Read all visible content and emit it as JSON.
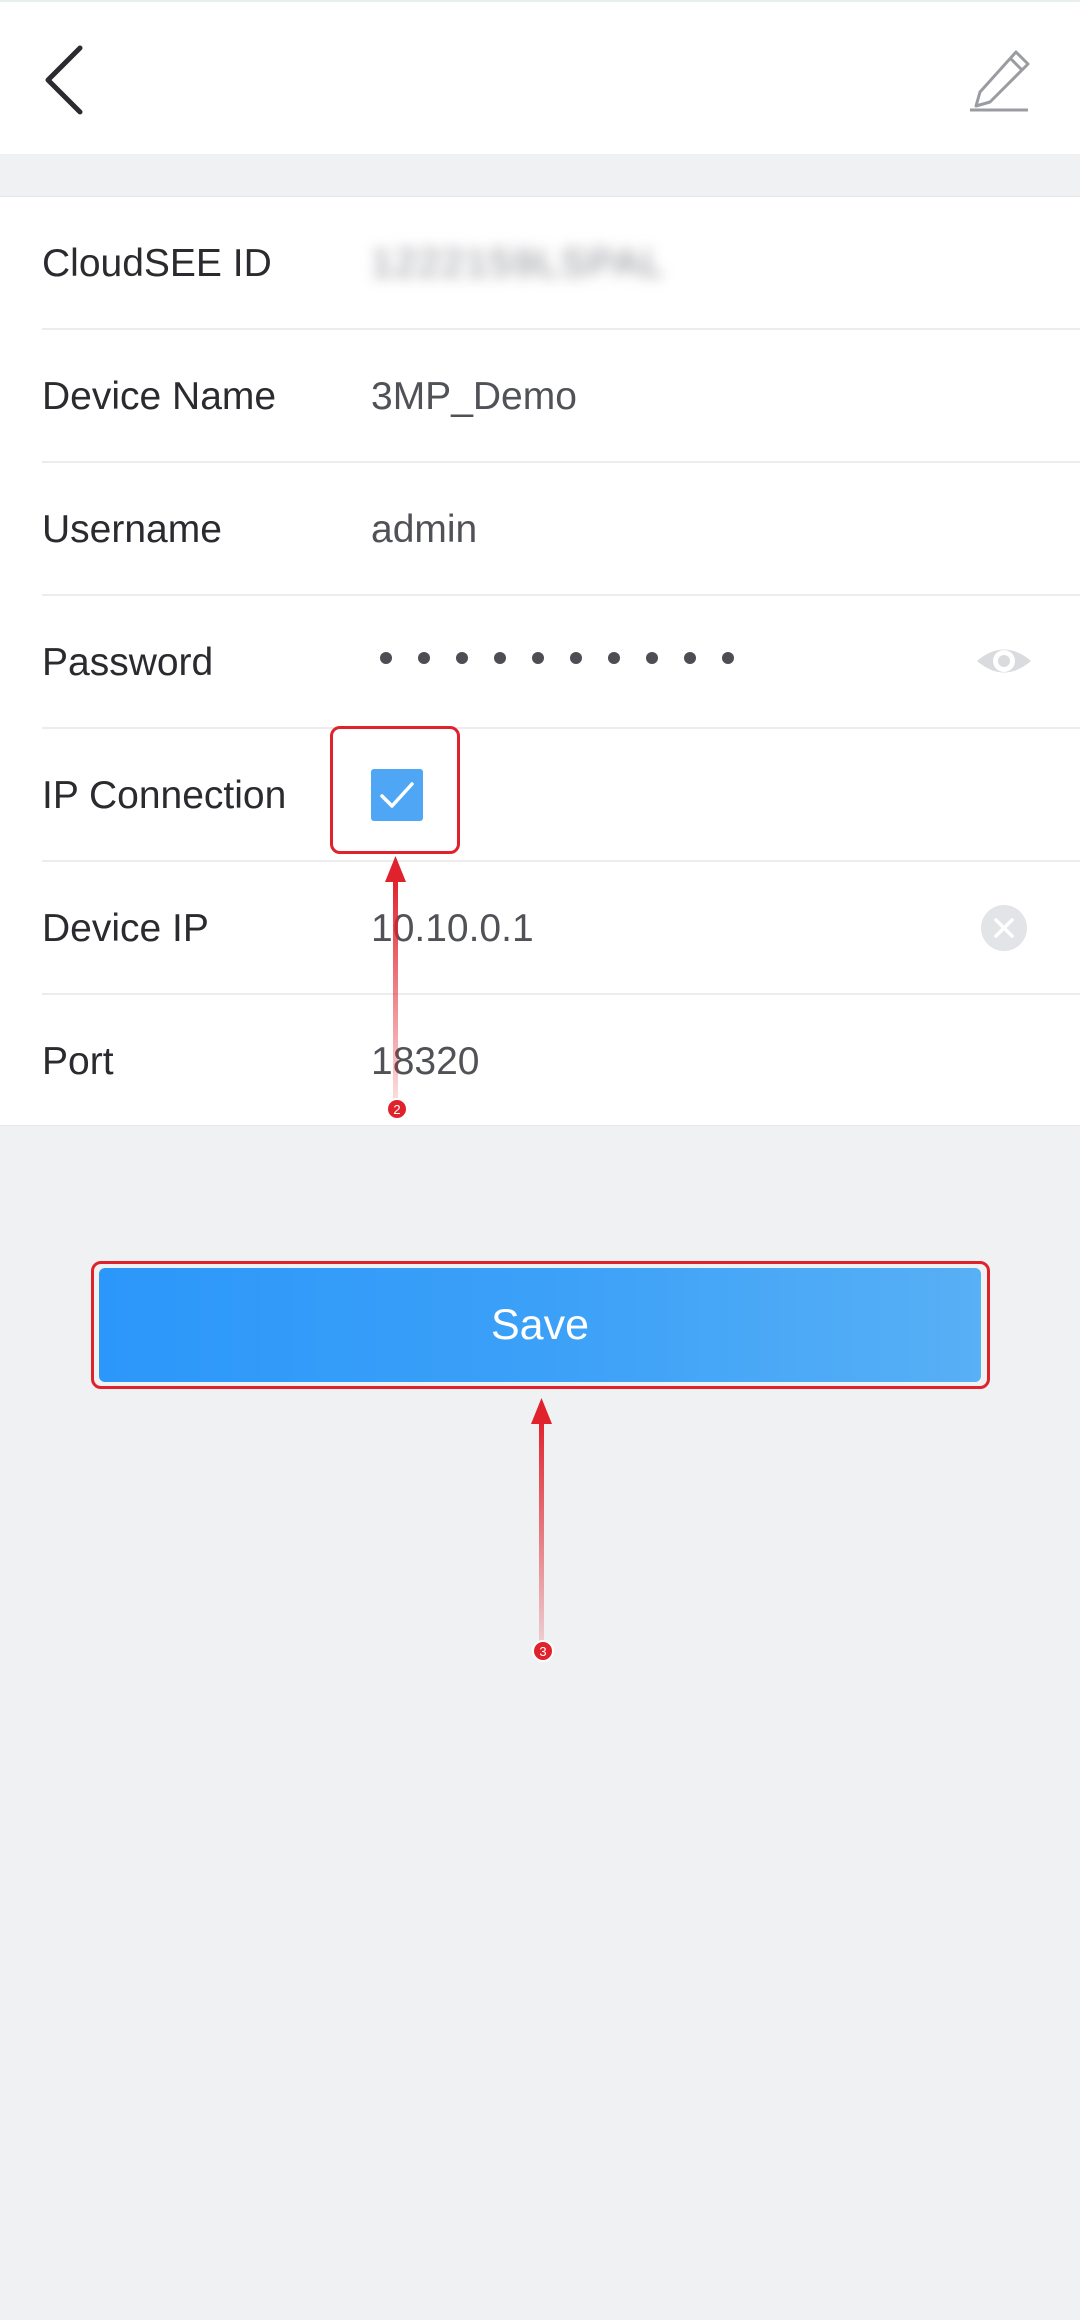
{
  "header": {
    "back_icon": "chevron-left-icon",
    "edit_icon": "pencil-icon"
  },
  "form": {
    "rows": [
      {
        "label": "CloudSEE ID",
        "value": "1222159LSPAL"
      },
      {
        "label": "Device Name",
        "value": "3MP_Demo"
      },
      {
        "label": "Username",
        "value": "admin"
      },
      {
        "label": "Password",
        "masked_length": 10,
        "reveal_icon": "eye-icon"
      },
      {
        "label": "IP Connection",
        "checked": true
      },
      {
        "label": "Device IP",
        "value": "10.10.0.1",
        "clear_icon": "clear-circle-icon"
      },
      {
        "label": "Port",
        "value": "18320"
      }
    ]
  },
  "actions": {
    "save_label": "Save"
  },
  "annotations": {
    "step_2": "2",
    "step_3": "3",
    "color": "#e0222c"
  },
  "colors": {
    "accent": "#3a9ff8",
    "background": "#f0f1f3"
  }
}
